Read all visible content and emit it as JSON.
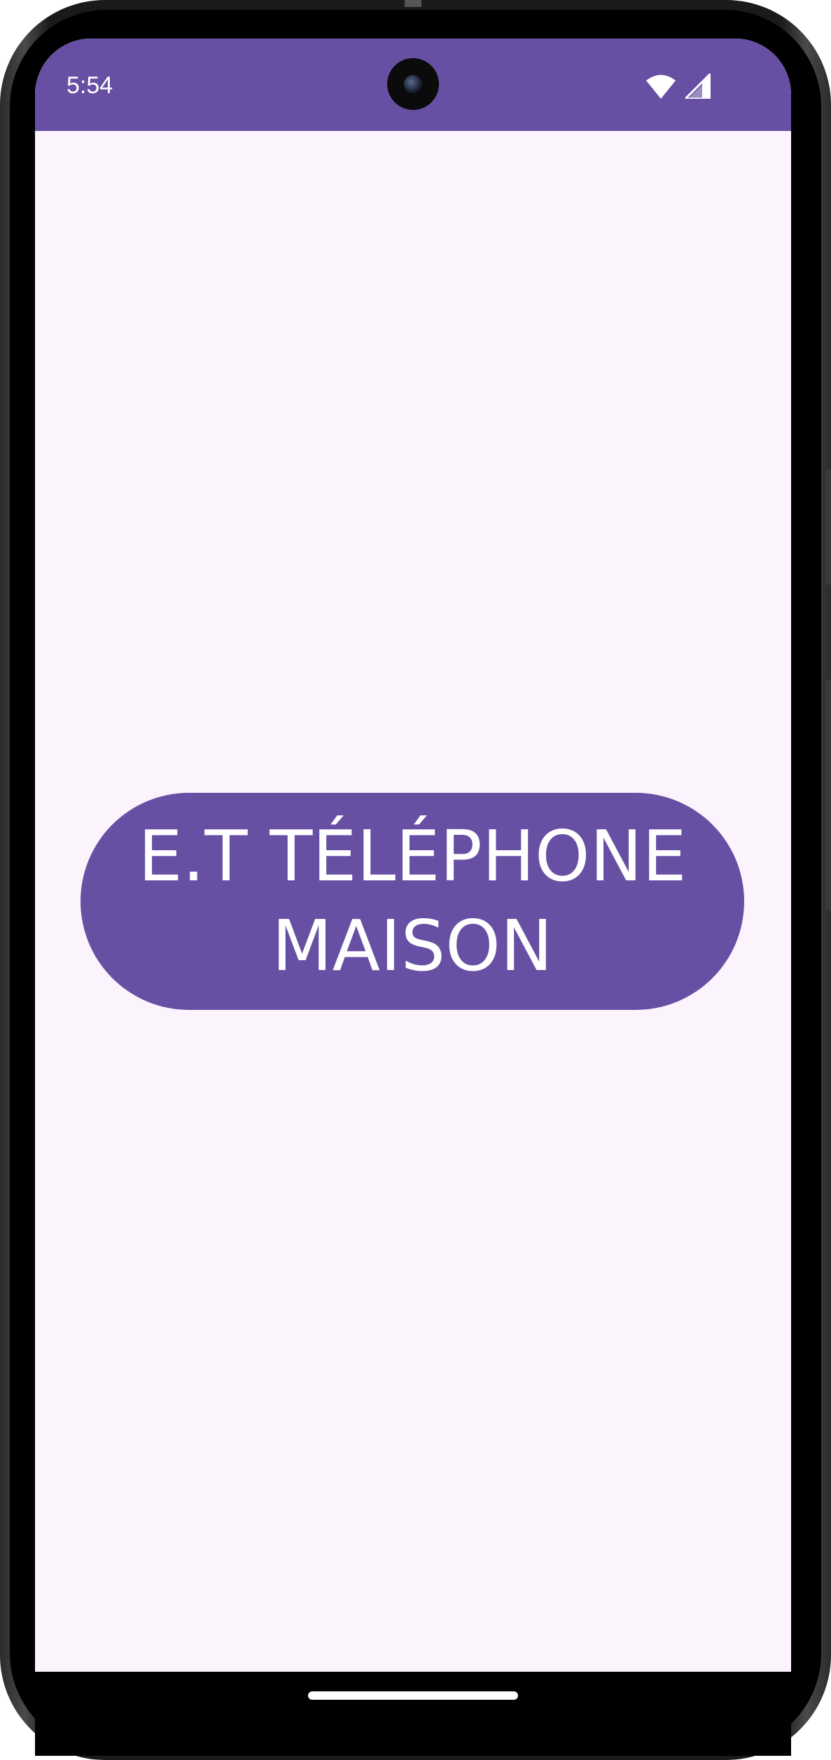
{
  "status_bar": {
    "time": "5:54",
    "background_color": "#6750a4",
    "icons": [
      "wifi-icon",
      "cellular-signal-icon"
    ]
  },
  "main": {
    "button_label": "E.T TÉLÉPHONE MAISON",
    "button_color": "#6750a4",
    "background_color": "#fcf4fc"
  },
  "navigation": {
    "gesture_bar": "gesture-handle"
  }
}
